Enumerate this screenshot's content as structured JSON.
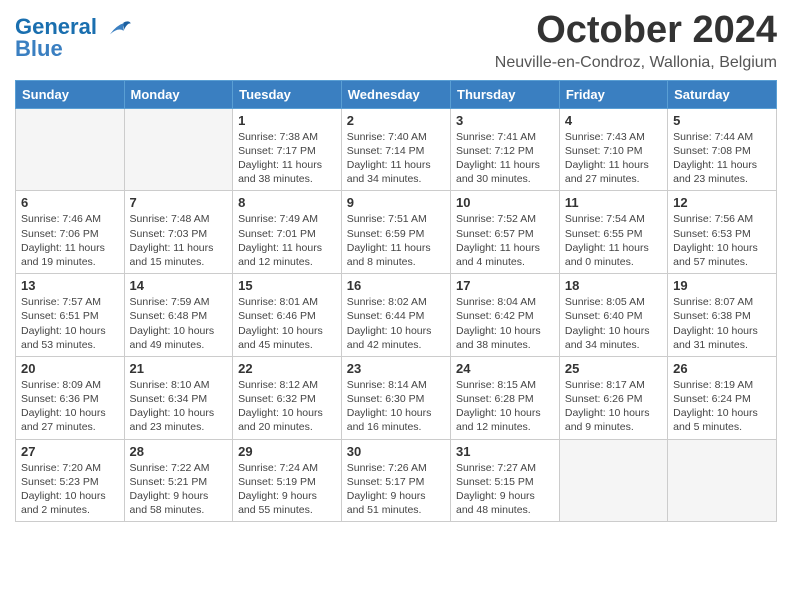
{
  "header": {
    "logo_line1": "General",
    "logo_line2": "Blue",
    "month": "October 2024",
    "location": "Neuville-en-Condroz, Wallonia, Belgium"
  },
  "weekdays": [
    "Sunday",
    "Monday",
    "Tuesday",
    "Wednesday",
    "Thursday",
    "Friday",
    "Saturday"
  ],
  "weeks": [
    [
      {
        "day": "",
        "info": ""
      },
      {
        "day": "",
        "info": ""
      },
      {
        "day": "1",
        "info": "Sunrise: 7:38 AM\nSunset: 7:17 PM\nDaylight: 11 hours and 38 minutes."
      },
      {
        "day": "2",
        "info": "Sunrise: 7:40 AM\nSunset: 7:14 PM\nDaylight: 11 hours and 34 minutes."
      },
      {
        "day": "3",
        "info": "Sunrise: 7:41 AM\nSunset: 7:12 PM\nDaylight: 11 hours and 30 minutes."
      },
      {
        "day": "4",
        "info": "Sunrise: 7:43 AM\nSunset: 7:10 PM\nDaylight: 11 hours and 27 minutes."
      },
      {
        "day": "5",
        "info": "Sunrise: 7:44 AM\nSunset: 7:08 PM\nDaylight: 11 hours and 23 minutes."
      }
    ],
    [
      {
        "day": "6",
        "info": "Sunrise: 7:46 AM\nSunset: 7:06 PM\nDaylight: 11 hours and 19 minutes."
      },
      {
        "day": "7",
        "info": "Sunrise: 7:48 AM\nSunset: 7:03 PM\nDaylight: 11 hours and 15 minutes."
      },
      {
        "day": "8",
        "info": "Sunrise: 7:49 AM\nSunset: 7:01 PM\nDaylight: 11 hours and 12 minutes."
      },
      {
        "day": "9",
        "info": "Sunrise: 7:51 AM\nSunset: 6:59 PM\nDaylight: 11 hours and 8 minutes."
      },
      {
        "day": "10",
        "info": "Sunrise: 7:52 AM\nSunset: 6:57 PM\nDaylight: 11 hours and 4 minutes."
      },
      {
        "day": "11",
        "info": "Sunrise: 7:54 AM\nSunset: 6:55 PM\nDaylight: 11 hours and 0 minutes."
      },
      {
        "day": "12",
        "info": "Sunrise: 7:56 AM\nSunset: 6:53 PM\nDaylight: 10 hours and 57 minutes."
      }
    ],
    [
      {
        "day": "13",
        "info": "Sunrise: 7:57 AM\nSunset: 6:51 PM\nDaylight: 10 hours and 53 minutes."
      },
      {
        "day": "14",
        "info": "Sunrise: 7:59 AM\nSunset: 6:48 PM\nDaylight: 10 hours and 49 minutes."
      },
      {
        "day": "15",
        "info": "Sunrise: 8:01 AM\nSunset: 6:46 PM\nDaylight: 10 hours and 45 minutes."
      },
      {
        "day": "16",
        "info": "Sunrise: 8:02 AM\nSunset: 6:44 PM\nDaylight: 10 hours and 42 minutes."
      },
      {
        "day": "17",
        "info": "Sunrise: 8:04 AM\nSunset: 6:42 PM\nDaylight: 10 hours and 38 minutes."
      },
      {
        "day": "18",
        "info": "Sunrise: 8:05 AM\nSunset: 6:40 PM\nDaylight: 10 hours and 34 minutes."
      },
      {
        "day": "19",
        "info": "Sunrise: 8:07 AM\nSunset: 6:38 PM\nDaylight: 10 hours and 31 minutes."
      }
    ],
    [
      {
        "day": "20",
        "info": "Sunrise: 8:09 AM\nSunset: 6:36 PM\nDaylight: 10 hours and 27 minutes."
      },
      {
        "day": "21",
        "info": "Sunrise: 8:10 AM\nSunset: 6:34 PM\nDaylight: 10 hours and 23 minutes."
      },
      {
        "day": "22",
        "info": "Sunrise: 8:12 AM\nSunset: 6:32 PM\nDaylight: 10 hours and 20 minutes."
      },
      {
        "day": "23",
        "info": "Sunrise: 8:14 AM\nSunset: 6:30 PM\nDaylight: 10 hours and 16 minutes."
      },
      {
        "day": "24",
        "info": "Sunrise: 8:15 AM\nSunset: 6:28 PM\nDaylight: 10 hours and 12 minutes."
      },
      {
        "day": "25",
        "info": "Sunrise: 8:17 AM\nSunset: 6:26 PM\nDaylight: 10 hours and 9 minutes."
      },
      {
        "day": "26",
        "info": "Sunrise: 8:19 AM\nSunset: 6:24 PM\nDaylight: 10 hours and 5 minutes."
      }
    ],
    [
      {
        "day": "27",
        "info": "Sunrise: 7:20 AM\nSunset: 5:23 PM\nDaylight: 10 hours and 2 minutes."
      },
      {
        "day": "28",
        "info": "Sunrise: 7:22 AM\nSunset: 5:21 PM\nDaylight: 9 hours and 58 minutes."
      },
      {
        "day": "29",
        "info": "Sunrise: 7:24 AM\nSunset: 5:19 PM\nDaylight: 9 hours and 55 minutes."
      },
      {
        "day": "30",
        "info": "Sunrise: 7:26 AM\nSunset: 5:17 PM\nDaylight: 9 hours and 51 minutes."
      },
      {
        "day": "31",
        "info": "Sunrise: 7:27 AM\nSunset: 5:15 PM\nDaylight: 9 hours and 48 minutes."
      },
      {
        "day": "",
        "info": ""
      },
      {
        "day": "",
        "info": ""
      }
    ]
  ]
}
